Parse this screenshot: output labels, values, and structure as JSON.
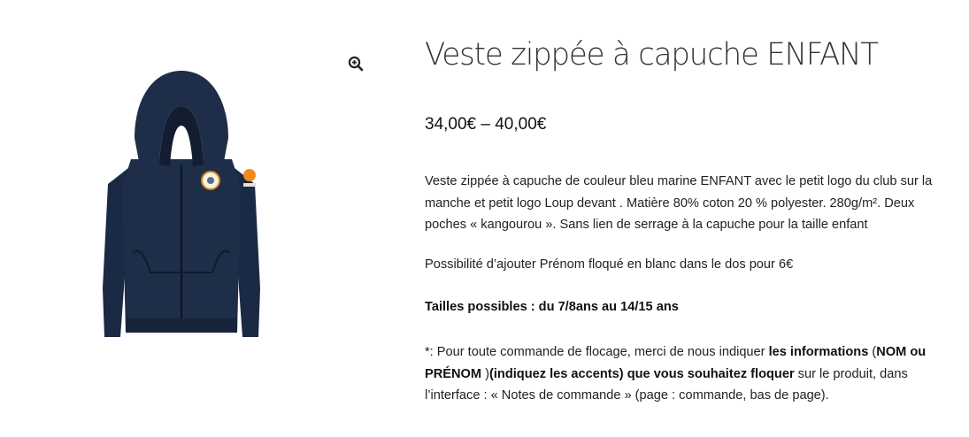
{
  "product": {
    "title": "Veste zippée à capuche ENFANT",
    "price_range": "34,00€ – 40,00€",
    "description": {
      "line1": "Veste zippée à capuche de couleur bleu marine ENFANT  avec le petit logo du club sur la",
      "line2": "manche et petit logo Loup devant . Matière 80% coton 20 % polyester. 280g/m². Deux",
      "line3": "poches « kangourou ». Sans lien de serrage à la capuche pour la taille enfant"
    },
    "name_option": "Possibilité d’ajouter Prénom floqué en blanc dans le dos pour 6€",
    "sizes": "Tailles possibles : du 7/8ans au 14/15 ans",
    "order_note": {
      "seg1": "*: Pour toute commande de flocage, merci de nous indiquer ",
      "seg2_bold": "les informations",
      "seg3": " (",
      "seg4_bold": "NOM ou",
      "seg5_bold": "PRÉNOM",
      "seg6": " )",
      "seg7_bold": "(indiquez les accents) que vous souhaitez floquer",
      "seg8": " sur le produit, dans",
      "seg9": "l’interface : « Notes de commande » (page : commande, bas de page)."
    }
  },
  "gallery": {
    "zoom_icon": "zoom-in-icon",
    "image": "navy-zip-hoodie",
    "jacket_color": "#1b2a44"
  }
}
